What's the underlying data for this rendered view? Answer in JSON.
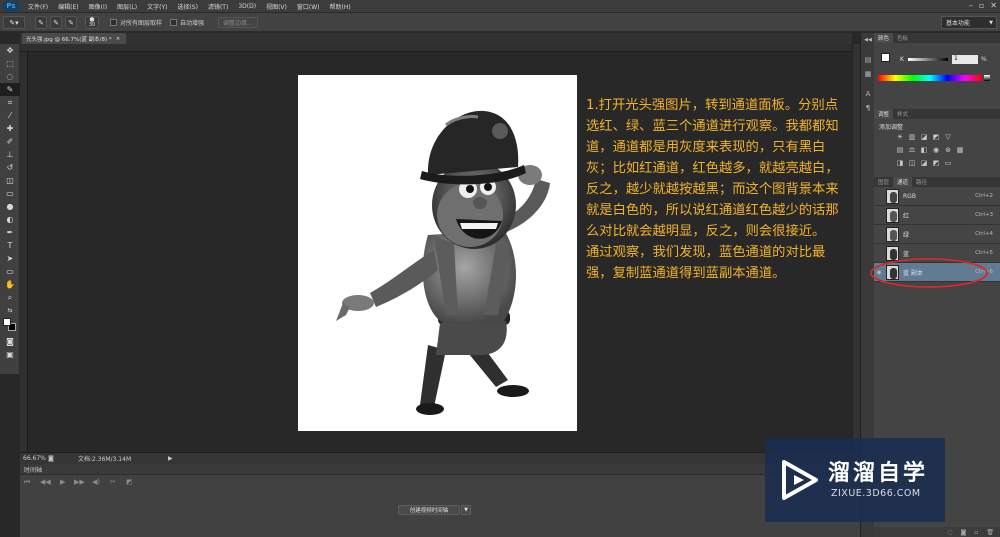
{
  "app": {
    "logo": "Ps"
  },
  "menu": [
    "文件(F)",
    "编辑(E)",
    "图像(I)",
    "图层(L)",
    "文字(Y)",
    "选择(S)",
    "滤镜(T)",
    "3D(D)",
    "视图(V)",
    "窗口(W)",
    "帮助(H)"
  ],
  "options_bar": {
    "brush_size": "30",
    "sample_all_layers": "对所有图层取样",
    "auto_enhance": "自动增强",
    "refine_edge": "调整边缘...",
    "workspace": "基本功能"
  },
  "document": {
    "tab_title": "光头强.jpg @ 66.7%(蓝 副本/8) *",
    "zoom": "66.67%",
    "doc_size": "文档:2.36M/3.14M"
  },
  "annotation": {
    "paragraph1": "1.打开光头强图片，转到通道面板。分别点选红、绿、蓝三个通道进行观察。我都都知道，通道都是用灰度来表现的，只有黑白灰；比如红通道，红色越多，就越亮越白，反之，越少就越按越黑；而这个图背景本来就是白色的，所以说红通道红色越少的话那么对比就会越明显，反之，则会很接近。",
    "paragraph2": "通过观察，我们发现，蓝色通道的对比最强，复制蓝通道得到蓝副本通道。"
  },
  "timeline": {
    "tab": "时间轴",
    "create_button": "创建视频时间轴"
  },
  "panels": {
    "color_tabs": [
      "颜色",
      "色板"
    ],
    "k_label": "K",
    "k_value": "1",
    "k_unit": "%",
    "adjust_tabs": [
      "调整",
      "样式"
    ],
    "adjust_title": "添加调整",
    "channel_tabs": [
      "图层",
      "通道",
      "路径"
    ],
    "channels": [
      {
        "name": "RGB",
        "shortcut": "Ctrl+2"
      },
      {
        "name": "红",
        "shortcut": "Ctrl+3"
      },
      {
        "name": "绿",
        "shortcut": "Ctrl+4"
      },
      {
        "name": "蓝",
        "shortcut": "Ctrl+5"
      },
      {
        "name": "蓝 副本",
        "shortcut": "Ctrl+6"
      }
    ]
  },
  "watermark": {
    "title": "溜溜自学",
    "subtitle": "ZIXUE.3D66.COM"
  },
  "colors": {
    "annotation": "#f1b22b",
    "highlight_ellipse": "#d12c2c",
    "selected_channel": "#617b93",
    "watermark_bg": "#1c3357"
  }
}
